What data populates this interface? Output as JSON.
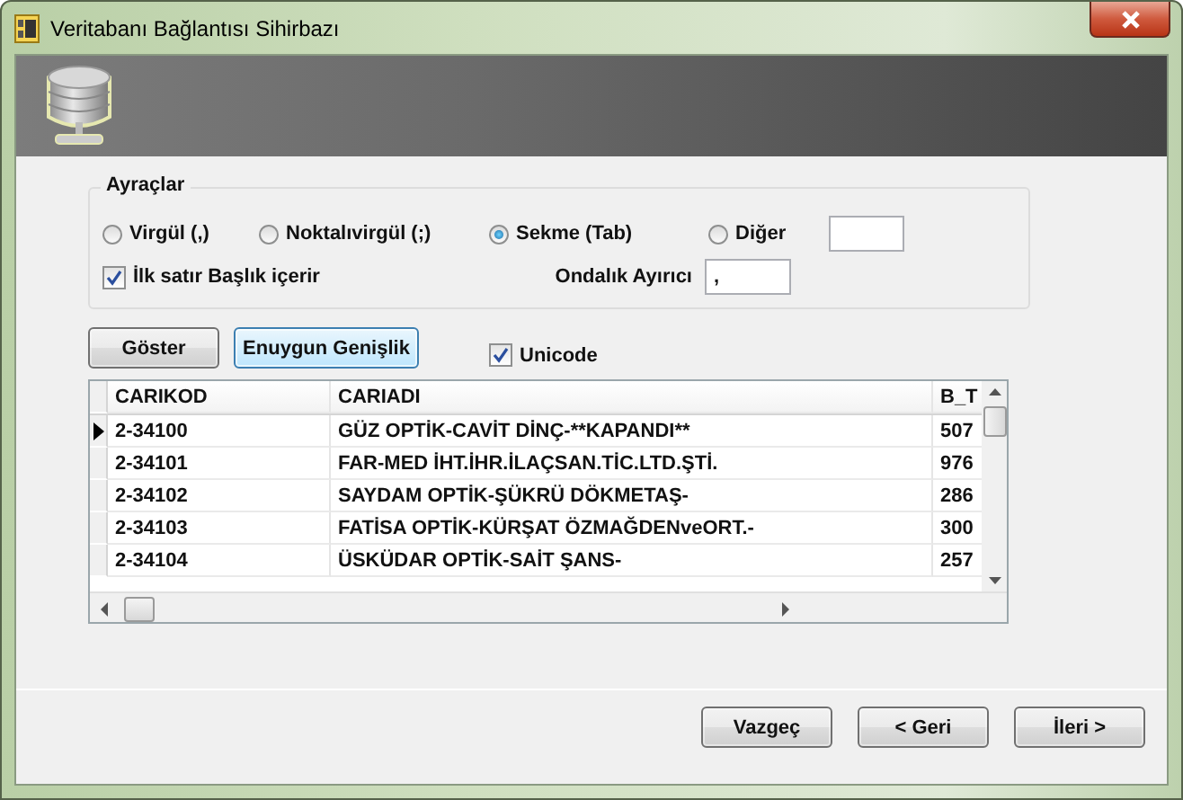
{
  "window": {
    "title": "Veritabanı Bağlantısı Sihirbazı"
  },
  "separators": {
    "title": "Ayraçlar",
    "options": [
      {
        "label": "Virgül (,)",
        "selected": false
      },
      {
        "label": "Noktalıvirgül (;)",
        "selected": false
      },
      {
        "label": "Sekme (Tab)",
        "selected": true
      },
      {
        "label": "Diğer",
        "selected": false
      }
    ],
    "first_row_header": {
      "label": "İlk satır Başlık içerir",
      "checked": true
    },
    "decimal": {
      "label": "Ondalık Ayırıcı",
      "value": ","
    }
  },
  "buttons": [
    {
      "label": "Göster",
      "focused": false
    },
    {
      "label": "Enuygun Genişlik",
      "focused": true
    }
  ],
  "unicode": {
    "label": "Unicode",
    "checked": true
  },
  "grid": {
    "columns": [
      "CARIKOD",
      "CARIADI",
      "B_T"
    ],
    "rows": [
      {
        "cells": [
          "2-34100",
          "GÜZ OPTİK-CAVİT DİNÇ-**KAPANDI**",
          "507"
        ],
        "selected": true
      },
      {
        "cells": [
          "2-34101",
          "FAR-MED İHT.İHR.İLAÇSAN.TİC.LTD.ŞTİ.",
          "976"
        ],
        "selected": false
      },
      {
        "cells": [
          "2-34102",
          "SAYDAM OPTİK-ŞÜKRÜ DÖKMETAŞ-",
          "286"
        ],
        "selected": false
      },
      {
        "cells": [
          "2-34103",
          "FATİSA OPTİK-KÜRŞAT ÖZMAĞDENveORT.-",
          "300"
        ],
        "selected": false
      },
      {
        "cells": [
          "2-34104",
          "ÜSKÜDAR OPTİK-SAİT ŞANS-",
          "257"
        ],
        "selected": false
      }
    ]
  },
  "footer_buttons": [
    "Vazgeç",
    "< Geri",
    "İleri >"
  ]
}
